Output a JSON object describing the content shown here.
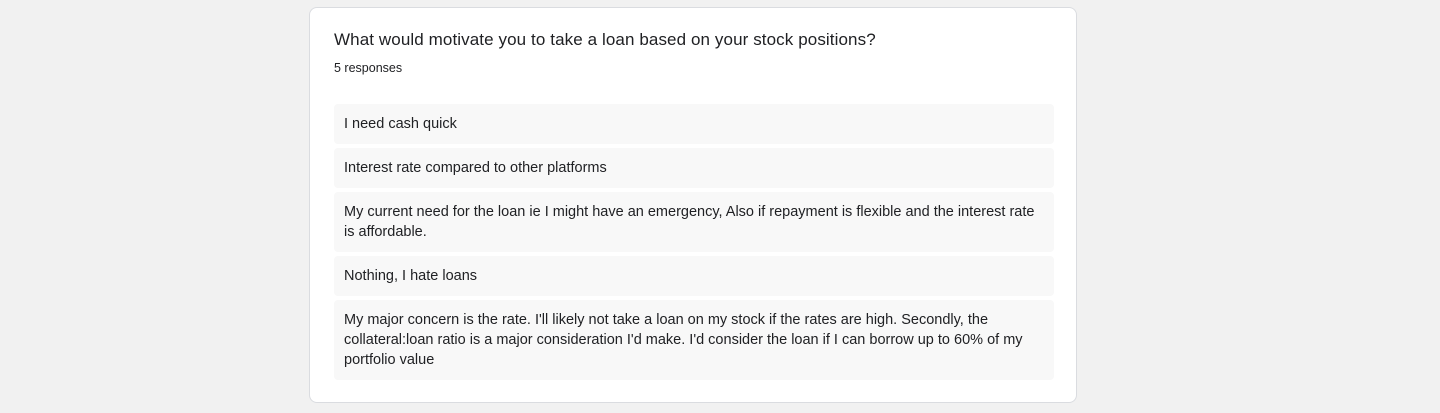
{
  "question": "What would motivate you to take a loan based on your stock positions?",
  "response_count": "5 responses",
  "responses": [
    "I need cash quick",
    "Interest rate compared to other platforms",
    "My current need for the loan ie I might have an emergency, Also if repayment is flexible and the interest rate is affordable.",
    "Nothing, I hate loans",
    "My major concern is the rate. I'll likely not take a loan on my stock if the rates are high. Secondly, the collateral:loan ratio is a major consideration I'd make. I'd consider the loan if I can borrow up to 60% of my portfolio value"
  ]
}
